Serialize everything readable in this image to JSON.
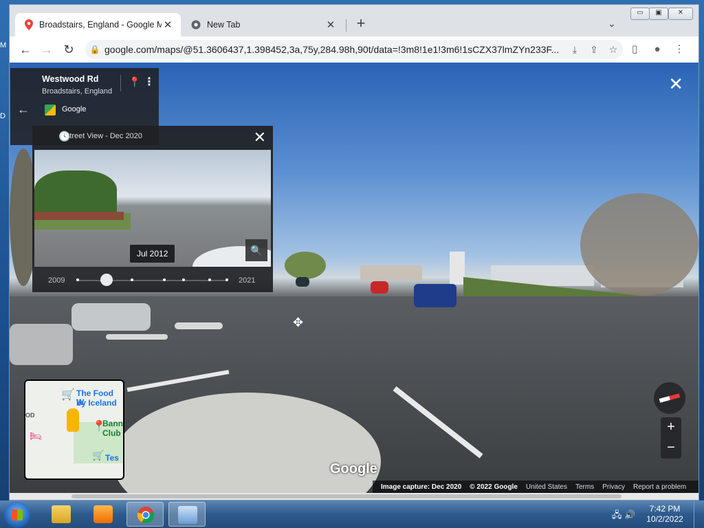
{
  "browser": {
    "tabs": [
      {
        "title": "Broadstairs, England - Google Maps",
        "active": true
      },
      {
        "title": "New Tab",
        "active": false
      }
    ],
    "url": "google.com/maps/@51.3606437,1.398452,3a,75y,284.98h,90t/data=!3m8!1e1!3m6!1sCZX37lmZYn233F..."
  },
  "location_card": {
    "road": "Westwood Rd",
    "place": "Broadstairs, England",
    "provider": "Google"
  },
  "time_panel": {
    "title": "Street View - Dec 2020",
    "selected_date": "Jul 2012",
    "start_year": "2009",
    "end_year": "2021",
    "selected_fraction": 0.2
  },
  "minimap": {
    "labels": [
      "The Food W",
      "by Iceland",
      "Bann",
      "Club",
      "Tes",
      "OD"
    ]
  },
  "attribution": {
    "logo": "Google",
    "capture": "Image capture: Dec 2020",
    "copyright": "© 2022 Google",
    "region": "United States",
    "terms": "Terms",
    "privacy": "Privacy",
    "report": "Report a problem"
  },
  "taskbar": {
    "time": "7:42 PM",
    "date": "10/2/2022"
  },
  "colors": {
    "accent": "#1a73e8",
    "panel": "#202124"
  }
}
